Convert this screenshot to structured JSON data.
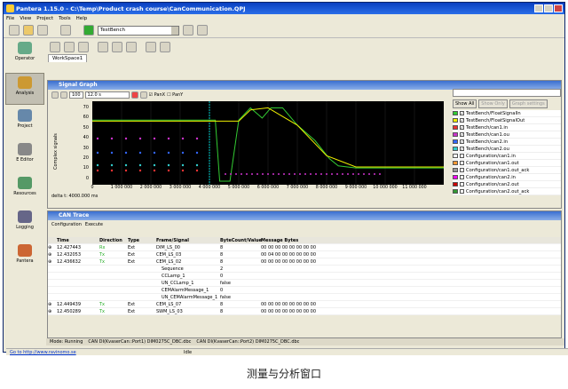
{
  "window": {
    "title": "Pantera 1.15.0 - C:\\Temp\\Product crash course\\CanCommunication.QPJ"
  },
  "menu": [
    "File",
    "View",
    "Project",
    "Tools",
    "Help"
  ],
  "toolbar": {
    "bench": "TestBench"
  },
  "sidebar": [
    {
      "label": "Operator",
      "icon": "operator-icon",
      "color": "#6a8"
    },
    {
      "label": "Analysis",
      "icon": "analysis-icon",
      "color": "#c93",
      "active": true
    },
    {
      "label": "Project",
      "icon": "project-icon",
      "color": "#68a"
    },
    {
      "label": "E Editor",
      "icon": "editor-icon",
      "color": "#888"
    },
    {
      "label": "Resources",
      "icon": "resources-icon",
      "color": "#596"
    },
    {
      "label": "Logging",
      "icon": "logging-icon",
      "color": "#668"
    },
    {
      "label": "Pantera",
      "icon": "pantera-icon",
      "color": "#c63"
    }
  ],
  "workspace_tab": "WorkSpace1",
  "signal_graph": {
    "title": "Signal Graph",
    "zoom": "100",
    "timebase": "12.0 s",
    "panx": "PanX",
    "pany": "PanY",
    "ylabel": "Complex signals",
    "yticks": [
      "70",
      "60",
      "50",
      "40",
      "30",
      "20",
      "10",
      "0"
    ],
    "xticks": [
      "0",
      "1 000 000",
      "2 000 000",
      "3 000 000",
      "4 000 000",
      "5 000 000",
      "6 000 000",
      "7 000 000",
      "8 000 000",
      "9 000 000",
      "10 000 000",
      "11 000 000"
    ],
    "delta": "delta t: 4000.000 ms",
    "buttons": {
      "show_all": "Show All",
      "show_only": "Show Only",
      "graph_settings": "Graph settings"
    },
    "signals": [
      {
        "name": "TestBench/FloatSignalIn",
        "color": "#3c3",
        "checked": true
      },
      {
        "name": "TestBench/FloatSignalOut",
        "color": "#ee0",
        "checked": true
      },
      {
        "name": "TestBench/can1.in",
        "color": "#e33",
        "checked": true
      },
      {
        "name": "TestBench/can1.ou",
        "color": "#c3c",
        "checked": true
      },
      {
        "name": "TestBench/can2.in",
        "color": "#36f",
        "checked": true
      },
      {
        "name": "TestBench/can2.ou",
        "color": "#3cc",
        "checked": true
      },
      {
        "name": "Configuration/can1.in",
        "color": "#fff",
        "checked": false
      },
      {
        "name": "Configuration/can1.out",
        "color": "#f93",
        "checked": false
      },
      {
        "name": "Configuration/can1.out_ack",
        "color": "#999",
        "checked": false
      },
      {
        "name": "Configuration/can2.in",
        "color": "#f0f",
        "checked": false
      },
      {
        "name": "Configuration/can2.out",
        "color": "#c00",
        "checked": false
      },
      {
        "name": "Configuration/can2.out_ack",
        "color": "#393",
        "checked": false
      }
    ]
  },
  "chart_data": {
    "type": "line",
    "ylabel": "Complex signals",
    "xlim": [
      0,
      12000000
    ],
    "ylim": [
      0,
      75
    ],
    "series": [
      {
        "color": "#3c3",
        "points": [
          [
            0,
            60
          ],
          [
            3900000,
            60
          ],
          [
            4200000,
            60
          ],
          [
            4350000,
            0
          ],
          [
            4700000,
            0
          ],
          [
            5000000,
            60
          ],
          [
            5400000,
            72
          ],
          [
            5800000,
            62
          ],
          [
            6100000,
            72
          ],
          [
            6500000,
            72
          ],
          [
            7000000,
            55
          ],
          [
            7600000,
            40
          ],
          [
            8100000,
            22
          ],
          [
            8400000,
            15
          ],
          [
            9000000,
            13
          ],
          [
            12000000,
            13
          ]
        ]
      },
      {
        "color": "#ee0",
        "points": [
          [
            0,
            59
          ],
          [
            4000000,
            59
          ],
          [
            5000000,
            59
          ],
          [
            5400000,
            70
          ],
          [
            6000000,
            72
          ],
          [
            7000000,
            55
          ],
          [
            8000000,
            25
          ],
          [
            9000000,
            14
          ],
          [
            12000000,
            14
          ]
        ]
      }
    ]
  },
  "can_trace": {
    "title": "CAN Trace",
    "tabs": [
      "Configuration",
      "Execute"
    ],
    "columns": [
      "Time",
      "Direction",
      "Type",
      "Frame/Signal",
      "ByteCount/Value",
      "Message Bytes"
    ],
    "rows": [
      {
        "time": "12.427443",
        "dir": "Rx",
        "type": "Ext",
        "frame": "DIM_LS_00",
        "val": "8",
        "bytes": "00 00 00 00 00 00 00 00"
      },
      {
        "time": "12.432053",
        "dir": "Tx",
        "type": "Ext",
        "frame": "CEM_LS_03",
        "val": "8",
        "bytes": "00 04 00 00 00 00 00 00"
      },
      {
        "time": "12.436632",
        "dir": "Tx",
        "type": "Ext",
        "frame": "CEM_LS_02",
        "val": "8",
        "bytes": "00 00 00 00 00 00 00 00"
      },
      {
        "time": "",
        "dir": "",
        "type": "",
        "frame": "Sequence",
        "val": "2",
        "bytes": ""
      },
      {
        "time": "",
        "dir": "",
        "type": "",
        "frame": "CCLamp_1",
        "val": "0",
        "bytes": ""
      },
      {
        "time": "",
        "dir": "",
        "type": "",
        "frame": "UN_CCLamp_1",
        "val": "false",
        "bytes": ""
      },
      {
        "time": "",
        "dir": "",
        "type": "",
        "frame": "CEMAlarmMessage_1",
        "val": "0",
        "bytes": ""
      },
      {
        "time": "",
        "dir": "",
        "type": "",
        "frame": "UN_CEMAlarmMessage_1",
        "val": "false",
        "bytes": ""
      },
      {
        "time": "12.449439",
        "dir": "Tx",
        "type": "Ext",
        "frame": "CEM_LS_07",
        "val": "8",
        "bytes": "00 00 00 00 00 00 00 00"
      },
      {
        "time": "12.450289",
        "dir": "Tx",
        "type": "Ext",
        "frame": "SWM_LS_03",
        "val": "8",
        "bytes": "00 00 00 00 00 00 00 00"
      }
    ]
  },
  "status": {
    "mode": "Mode: Running",
    "can1": "CAN DI(KvaserCan::Port1) DIM0275C_DBC.dbc",
    "can2": "CAN DI(KvaserCan::Port2) DIM0275C_DBC.dbc"
  },
  "bottom": {
    "link": "Go to http://www.ravinomo.se",
    "state": "Idle"
  },
  "caption": "测量与分析窗口"
}
